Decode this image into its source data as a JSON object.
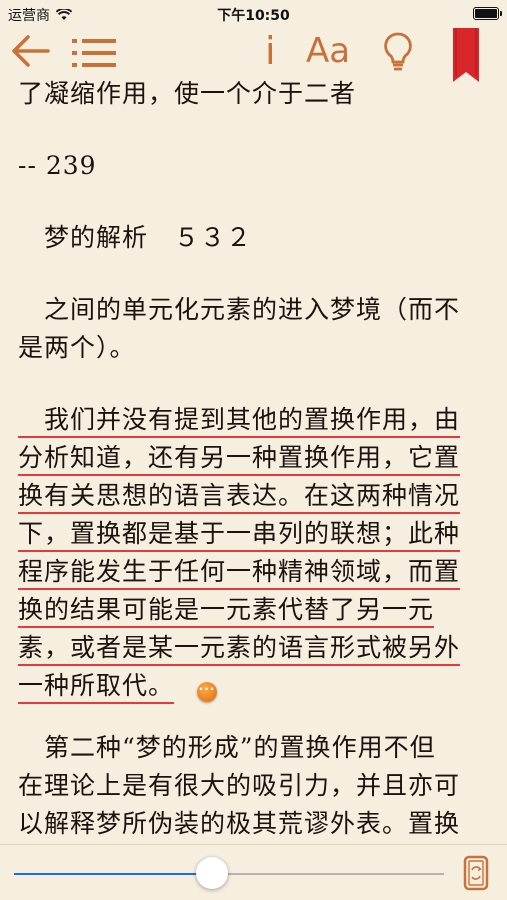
{
  "status_bar": {
    "carrier": "运营商",
    "time": "下午10:50"
  },
  "toolbar": {
    "back_icon": "back-arrow-icon",
    "toc_icon": "list-icon",
    "info_label": "i",
    "font_label": "Aa",
    "bulb_icon": "lightbulb-icon",
    "bookmark_icon": "bookmark-icon",
    "accent_color": "#c8723a",
    "bookmark_color": "#d9262b"
  },
  "content": {
    "lines": [
      "了凝缩作用，使一个介于二者",
      "-- 239",
      "　梦的解析　５３２",
      "　之间的单元化元素的进入梦境（而不",
      "是两个）。",
      "　我们并没有提到其他的置换作用，由",
      "分析知道，还有另一种置换作用，它置",
      "换有关思想的语言表达。在这两种情况",
      "下，置换都是基于一串列的联想；此种",
      "程序能发生于任何一种精神领域，而置",
      "换的结果可能是一元素代替了另一元",
      "素，或者是某一元素的语言形式被另外",
      "一种所取代。",
      "　第二种“梦的形成”的置换作用不但",
      "在理论上是有很大的吸引力，并且亦可",
      "以解释梦所伪装的极其荒谬外表。置换"
    ],
    "highlight_color": "#e23b3b",
    "note_icon": "note-icon"
  },
  "bottom_bar": {
    "progress": 0.46,
    "rotate_icon": "rotate-lock-icon"
  }
}
